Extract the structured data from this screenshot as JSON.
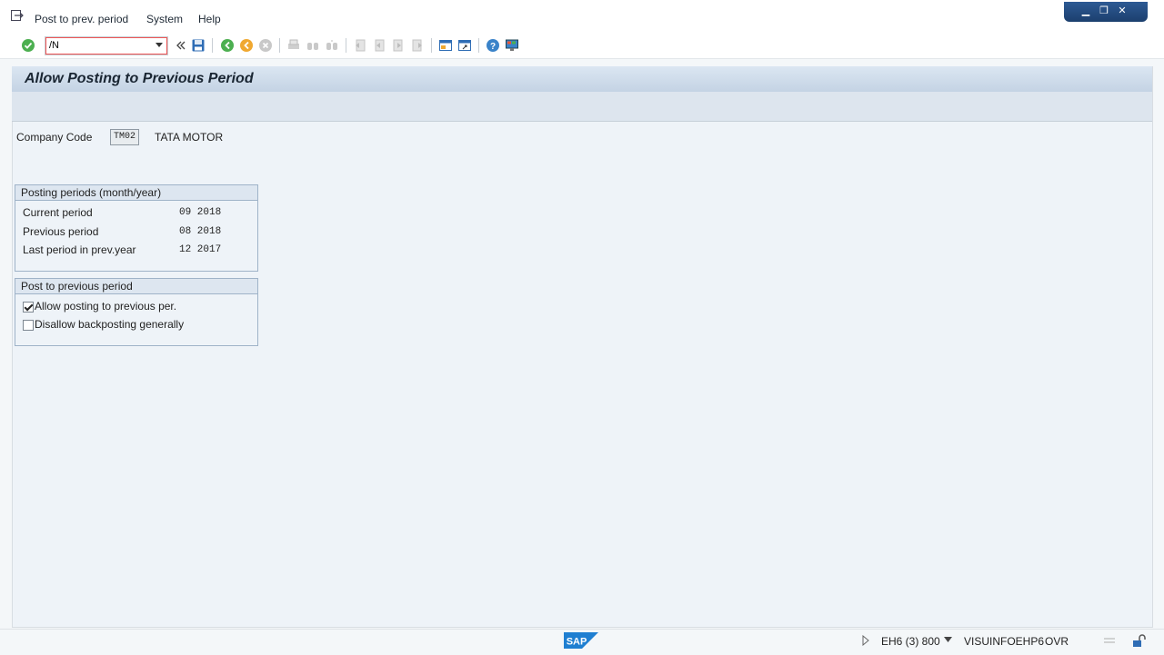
{
  "menubar": {
    "items": [
      "Post to prev. period",
      "System",
      "Help"
    ]
  },
  "window_controls": [
    "minimize-icon",
    "restore-icon",
    "close-icon"
  ],
  "toolbar": {
    "command_field_value": "/N",
    "icons": [
      "enter-icon",
      "command-dropdown-icon",
      "collapse-icon",
      "save-icon",
      "back-icon",
      "exit-icon",
      "cancel-icon",
      "print-icon",
      "find-icon",
      "find-next-icon",
      "first-page-icon",
      "previous-page-icon",
      "next-page-icon",
      "last-page-icon",
      "create-session-icon",
      "shortcut-icon",
      "help-icon",
      "customize-layout-icon"
    ]
  },
  "page": {
    "title": "Allow Posting to Previous Period"
  },
  "company": {
    "label": "Company Code",
    "code": "TM02",
    "name": "TATA MOTOR"
  },
  "posting_periods": {
    "title": "Posting periods (month/year)",
    "rows": [
      {
        "label": "Current period",
        "value": "09  2018"
      },
      {
        "label": "Previous period",
        "value": "08  2018"
      },
      {
        "label": "Last period in prev.year",
        "value": "12  2017"
      }
    ]
  },
  "post_previous": {
    "title": "Post to previous period",
    "options": [
      {
        "label": "Allow posting to previous per.",
        "checked": true
      },
      {
        "label": "Disallow backposting generally",
        "checked": false
      }
    ]
  },
  "statusbar": {
    "logo": "SAP",
    "system": "EH6 (3) 800",
    "server": "VISUINFOEHP6",
    "mode": "OVR"
  },
  "colors": {
    "title_bar": "#c4d3e4",
    "background": "#eef3f8",
    "group_border": "#9fb3c8",
    "accent_blue": "#2d5a94"
  }
}
